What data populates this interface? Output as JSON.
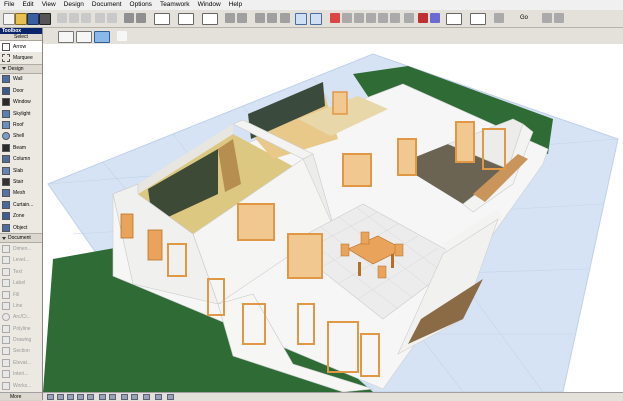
{
  "menu": [
    "File",
    "Edit",
    "View",
    "Design",
    "Document",
    "Options",
    "Teamwork",
    "Window",
    "Help"
  ],
  "toolbar": {
    "go_label": "Go"
  },
  "toolbox": {
    "title": "Toolbox",
    "select_label": "Select",
    "select_tools": [
      "Arrow",
      "Marquee"
    ],
    "design_label": "Design",
    "design_tools": [
      "Wall",
      "Door",
      "Window",
      "Skylight",
      "Roof",
      "Shell",
      "Beam",
      "Column",
      "Slab",
      "Stair",
      "Mesh",
      "Curtain...",
      "Zone",
      "Object"
    ],
    "document_label": "Document",
    "document_tools": [
      "Dimen...",
      "Level...",
      "Text",
      "Label",
      "Fill",
      "Line",
      "Arc/Ci...",
      "Polyline",
      "Drawing",
      "Section",
      "Elevat...",
      "Interi...",
      "Works..."
    ],
    "more_label": "More"
  },
  "colors": {
    "grass": "#2e6b35",
    "grid": "#d6e3f4",
    "wall": "#f3f3f1",
    "floor": "#dcc880",
    "tile": "#ececec",
    "wood": "#e9a35a",
    "carpet": "#6b6452"
  }
}
